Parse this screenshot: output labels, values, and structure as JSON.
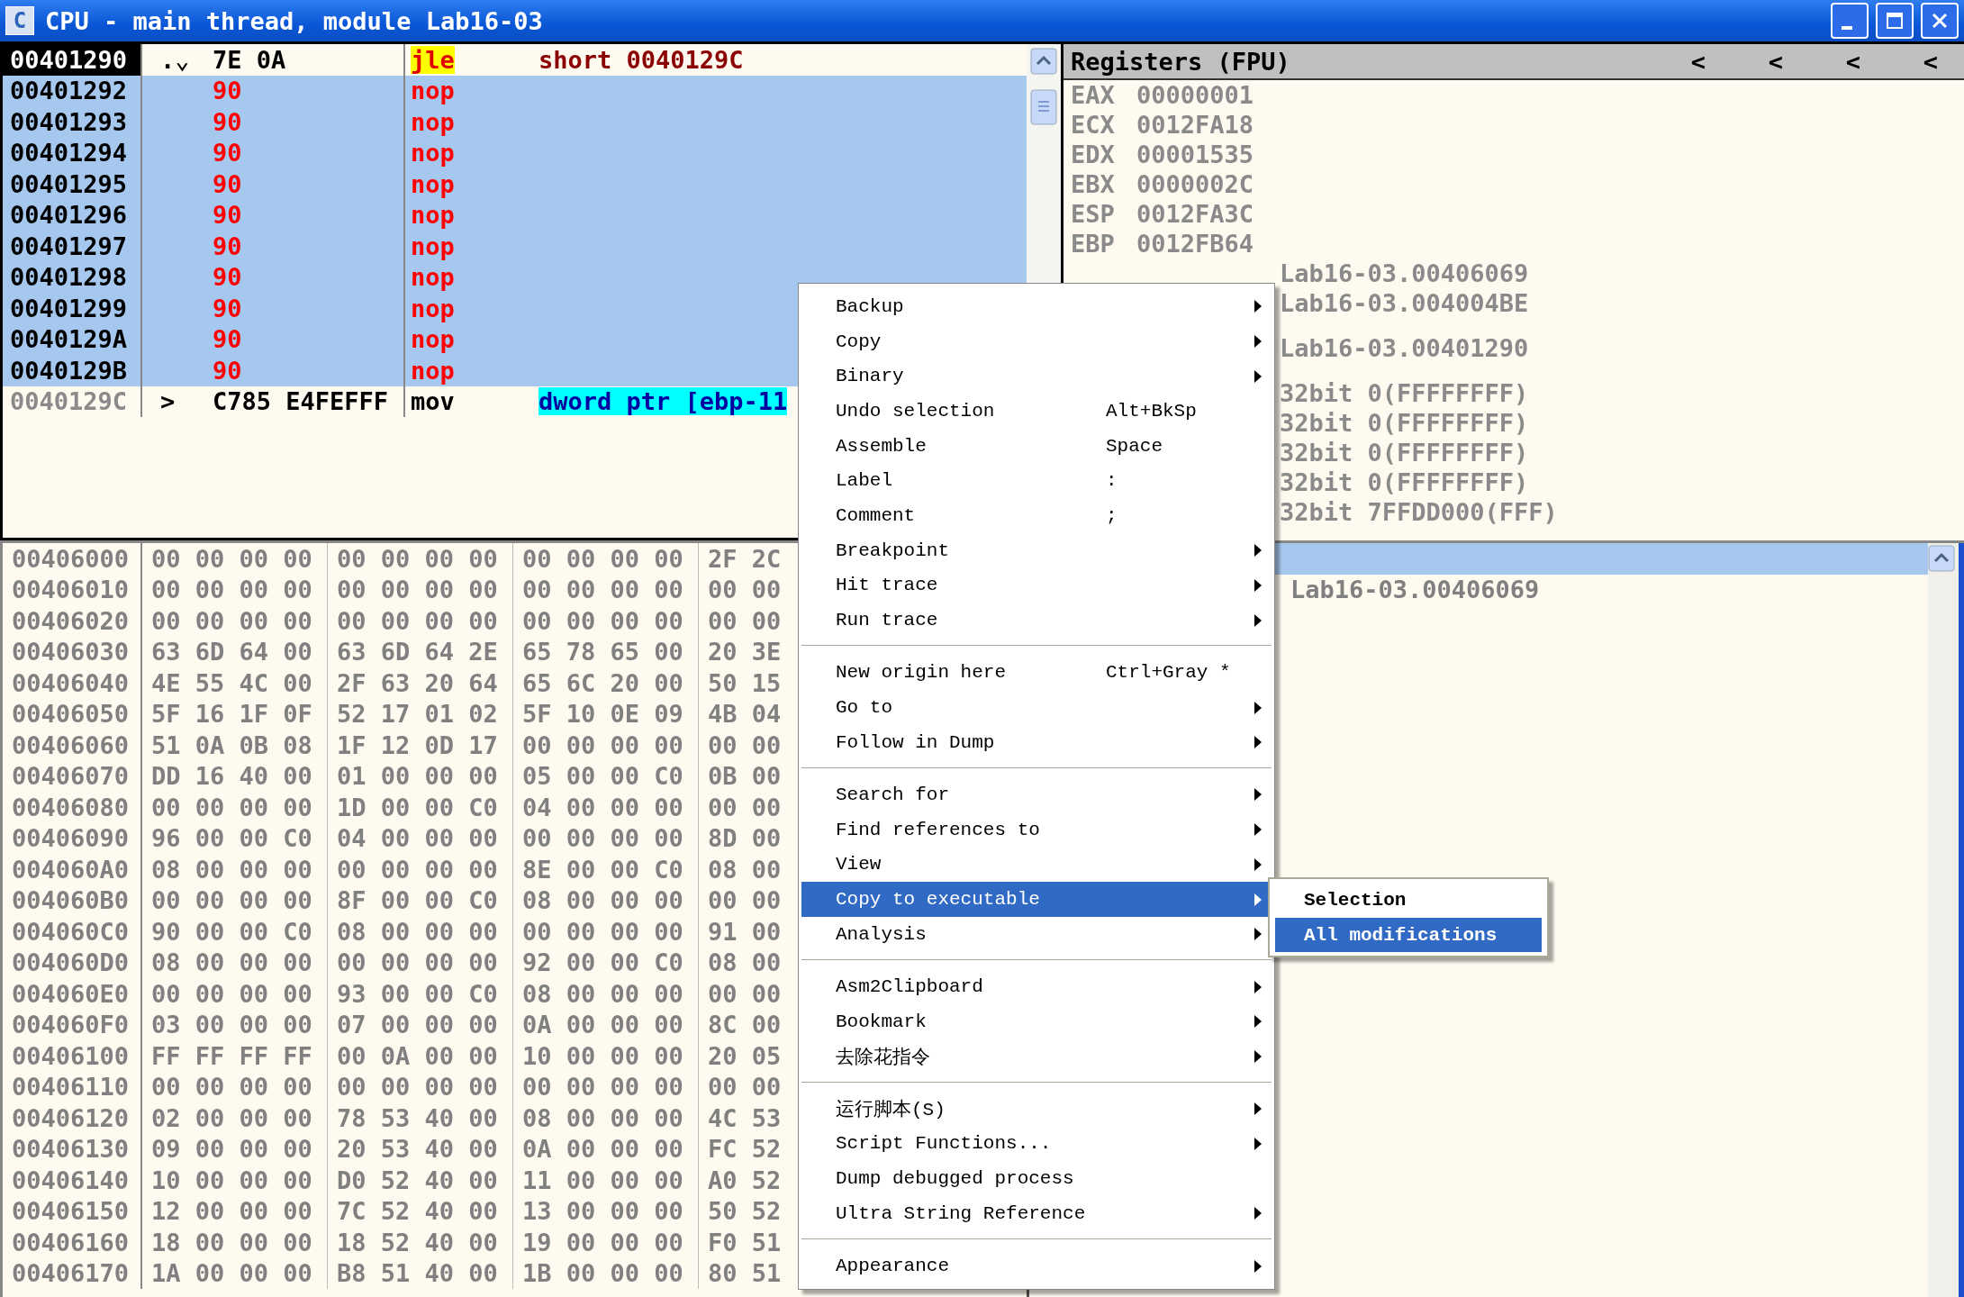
{
  "window": {
    "icon_letter": "C",
    "title": "CPU - main thread, module Lab16-03"
  },
  "disassembly": {
    "rows": [
      {
        "address": "00401290",
        "marker": ".⌄",
        "hex": "7E 0A",
        "mnemonic": "jle",
        "highlighted": true,
        "operand": "short 0040129C",
        "operand_highlight": false,
        "current": true,
        "selected": false,
        "modified": false
      },
      {
        "address": "00401292",
        "hex": "90",
        "mnemonic": "nop",
        "highlighted": false,
        "current": false,
        "selected": true,
        "modified": true
      },
      {
        "address": "00401293",
        "hex": "90",
        "mnemonic": "nop",
        "highlighted": false,
        "current": false,
        "selected": true,
        "modified": true
      },
      {
        "address": "00401294",
        "hex": "90",
        "mnemonic": "nop",
        "highlighted": false,
        "current": false,
        "selected": true,
        "modified": true
      },
      {
        "address": "00401295",
        "hex": "90",
        "mnemonic": "nop",
        "highlighted": false,
        "current": false,
        "selected": true,
        "modified": true
      },
      {
        "address": "00401296",
        "hex": "90",
        "mnemonic": "nop",
        "highlighted": false,
        "current": false,
        "selected": true,
        "modified": true
      },
      {
        "address": "00401297",
        "hex": "90",
        "mnemonic": "nop",
        "highlighted": false,
        "current": false,
        "selected": true,
        "modified": true
      },
      {
        "address": "00401298",
        "hex": "90",
        "mnemonic": "nop",
        "highlighted": false,
        "current": false,
        "selected": true,
        "modified": true
      },
      {
        "address": "00401299",
        "hex": "90",
        "mnemonic": "nop",
        "highlighted": false,
        "current": false,
        "selected": true,
        "modified": true
      },
      {
        "address": "0040129A",
        "hex": "90",
        "mnemonic": "nop",
        "highlighted": false,
        "current": false,
        "selected": true,
        "modified": true
      },
      {
        "address": "0040129B",
        "hex": "90",
        "mnemonic": "nop",
        "highlighted": false,
        "current": false,
        "selected": true,
        "modified": true
      },
      {
        "address": "0040129C",
        "marker": ">",
        "hex": "C785 E4FEFFF",
        "mnemonic": "mov",
        "highlighted": false,
        "operand": "dword ptr [ebp-11",
        "operand_highlight": true,
        "current": false,
        "selected": false,
        "modified": false
      }
    ]
  },
  "registers": {
    "title": "Registers (FPU)",
    "header_buttons": [
      "<",
      "<",
      "<",
      "<"
    ],
    "rows": [
      {
        "kind": "full",
        "name": "EAX",
        "value": "00000001",
        "spaced": false
      },
      {
        "kind": "full",
        "name": "ECX",
        "value": "0012FA18",
        "spaced": false
      },
      {
        "kind": "full",
        "name": "EDX",
        "value": "00001535",
        "spaced": false
      },
      {
        "kind": "full",
        "name": "EBX",
        "value": "0000002C",
        "spaced": false
      },
      {
        "kind": "full",
        "name": "ESP",
        "value": "0012FA3C",
        "spaced": false
      },
      {
        "kind": "full",
        "name": "EBP",
        "value": "0012FB64",
        "spaced": false
      },
      {
        "kind": "tail",
        "text": "Lab16-03.00406069",
        "spaced": false
      },
      {
        "kind": "tail",
        "text": "Lab16-03.004004BE",
        "spaced": false
      },
      {
        "kind": "tail",
        "text": "Lab16-03.00401290",
        "spaced": true
      },
      {
        "kind": "tail",
        "text": "32bit 0(FFFFFFFF)",
        "spaced": true
      },
      {
        "kind": "tail",
        "text": "32bit 0(FFFFFFFF)",
        "spaced": false
      },
      {
        "kind": "tail",
        "text": "32bit 0(FFFFFFFF)",
        "spaced": false
      },
      {
        "kind": "tail",
        "text": "32bit 0(FFFFFFFF)",
        "spaced": false
      },
      {
        "kind": "tail",
        "text": "32bit 7FFDD000(FFF)",
        "spaced": false
      }
    ]
  },
  "dump": {
    "rows": [
      {
        "address": "00406000",
        "groups": [
          "00 00 00 00",
          "00 00 00 00",
          "00 00 00 00",
          "2F 2C"
        ]
      },
      {
        "address": "00406010",
        "groups": [
          "00 00 00 00",
          "00 00 00 00",
          "00 00 00 00",
          "00 00"
        ]
      },
      {
        "address": "00406020",
        "groups": [
          "00 00 00 00",
          "00 00 00 00",
          "00 00 00 00",
          "00 00"
        ]
      },
      {
        "address": "00406030",
        "groups": [
          "63 6D 64 00",
          "63 6D 64 2E",
          "65 78 65 00",
          "20 3E"
        ]
      },
      {
        "address": "00406040",
        "groups": [
          "4E 55 4C 00",
          "2F 63 20 64",
          "65 6C 20 00",
          "50 15"
        ]
      },
      {
        "address": "00406050",
        "groups": [
          "5F 16 1F 0F",
          "52 17 01 02",
          "5F 10 0E 09",
          "4B 04"
        ]
      },
      {
        "address": "00406060",
        "groups": [
          "51 0A 0B 08",
          "1F 12 0D 17",
          "00 00 00 00",
          "00 00"
        ]
      },
      {
        "address": "00406070",
        "groups": [
          "DD 16 40 00",
          "01 00 00 00",
          "05 00 00 C0",
          "0B 00"
        ]
      },
      {
        "address": "00406080",
        "groups": [
          "00 00 00 00",
          "1D 00 00 C0",
          "04 00 00 00",
          "00 00"
        ]
      },
      {
        "address": "00406090",
        "groups": [
          "96 00 00 C0",
          "04 00 00 00",
          "00 00 00 00",
          "8D 00"
        ]
      },
      {
        "address": "004060A0",
        "groups": [
          "08 00 00 00",
          "00 00 00 00",
          "8E 00 00 C0",
          "08 00"
        ]
      },
      {
        "address": "004060B0",
        "groups": [
          "00 00 00 00",
          "8F 00 00 C0",
          "08 00 00 00",
          "00 00"
        ]
      },
      {
        "address": "004060C0",
        "groups": [
          "90 00 00 C0",
          "08 00 00 00",
          "00 00 00 00",
          "91 00"
        ]
      },
      {
        "address": "004060D0",
        "groups": [
          "08 00 00 00",
          "00 00 00 00",
          "92 00 00 C0",
          "08 00"
        ]
      },
      {
        "address": "004060E0",
        "groups": [
          "00 00 00 00",
          "93 00 00 C0",
          "08 00 00 00",
          "00 00"
        ]
      },
      {
        "address": "004060F0",
        "groups": [
          "03 00 00 00",
          "07 00 00 00",
          "0A 00 00 00",
          "8C 00"
        ]
      },
      {
        "address": "00406100",
        "groups": [
          "FF FF FF FF",
          "00 0A 00 00",
          "10 00 00 00",
          "20 05"
        ]
      },
      {
        "address": "00406110",
        "groups": [
          "00 00 00 00",
          "00 00 00 00",
          "00 00 00 00",
          "00 00"
        ]
      },
      {
        "address": "00406120",
        "groups": [
          "02 00 00 00",
          "78 53 40 00",
          "08 00 00 00",
          "4C 53"
        ]
      },
      {
        "address": "00406130",
        "groups": [
          "09 00 00 00",
          "20 53 40 00",
          "0A 00 00 00",
          "FC 52"
        ]
      },
      {
        "address": "00406140",
        "groups": [
          "10 00 00 00",
          "D0 52 40 00",
          "11 00 00 00",
          "A0 52"
        ]
      },
      {
        "address": "00406150",
        "groups": [
          "12 00 00 00",
          "7C 52 40 00",
          "13 00 00 00",
          "50 52"
        ]
      },
      {
        "address": "00406160",
        "groups": [
          "18 00 00 00",
          "18 52 40 00",
          "19 00 00 00",
          "F0 51"
        ]
      },
      {
        "address": "00406170",
        "groups": [
          "1A 00 00 00",
          "B8 51 40 00",
          "1B 00 00 00",
          "80 51"
        ]
      }
    ]
  },
  "stack": {
    "rows": [
      {
        "selected": true
      },
      {
        "selected": false,
        "comment": "Lab16-03.00406069"
      }
    ]
  },
  "menu": {
    "groups": [
      [
        {
          "label": "Backup",
          "submenu": true,
          "selected": false
        },
        {
          "label": "Copy",
          "submenu": true,
          "selected": false
        },
        {
          "label": "Binary",
          "submenu": true,
          "selected": false
        },
        {
          "label": "Undo selection",
          "shortcut": "Alt+BkSp",
          "submenu": false,
          "selected": false
        },
        {
          "label": "Assemble",
          "shortcut": "Space",
          "submenu": false,
          "selected": false
        },
        {
          "label": "Label",
          "shortcut": ":",
          "submenu": false,
          "selected": false
        },
        {
          "label": "Comment",
          "shortcut": ";",
          "submenu": false,
          "selected": false
        },
        {
          "label": "Breakpoint",
          "submenu": true,
          "selected": false
        },
        {
          "label": "Hit trace",
          "submenu": true,
          "selected": false
        },
        {
          "label": "Run trace",
          "submenu": true,
          "selected": false
        }
      ],
      [
        {
          "label": "New origin here",
          "shortcut": "Ctrl+Gray *",
          "submenu": false,
          "selected": false
        },
        {
          "label": "Go to",
          "submenu": true,
          "selected": false
        },
        {
          "label": "Follow in Dump",
          "submenu": true,
          "selected": false
        }
      ],
      [
        {
          "label": "Search for",
          "submenu": true,
          "selected": false
        },
        {
          "label": "Find references to",
          "submenu": true,
          "selected": false
        },
        {
          "label": "View",
          "submenu": true,
          "selected": false
        },
        {
          "label": "Copy to executable",
          "submenu": true,
          "selected": true
        },
        {
          "label": "Analysis",
          "submenu": true,
          "selected": false
        }
      ],
      [
        {
          "label": "Asm2Clipboard",
          "submenu": true,
          "selected": false
        },
        {
          "label": "Bookmark",
          "submenu": true,
          "selected": false
        },
        {
          "label": "去除花指令",
          "submenu": true,
          "selected": false
        }
      ],
      [
        {
          "label": "运行脚本(S)",
          "submenu": true,
          "selected": false
        },
        {
          "label": "Script Functions...",
          "submenu": true,
          "selected": false
        },
        {
          "label": "Dump debugged process",
          "submenu": false,
          "selected": false
        },
        {
          "label": "Ultra String Reference",
          "submenu": true,
          "selected": false
        }
      ],
      [
        {
          "label": "Appearance",
          "submenu": true,
          "selected": false
        }
      ]
    ]
  },
  "submenu": {
    "items": [
      {
        "label": "Selection",
        "selected": false
      },
      {
        "label": "All modifications",
        "selected": true
      }
    ]
  }
}
